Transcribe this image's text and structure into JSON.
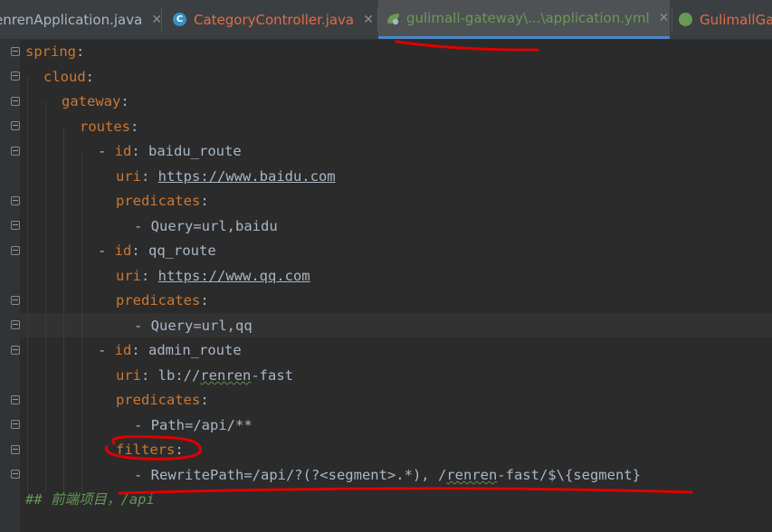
{
  "tabs": [
    {
      "label": "enrenApplication.java",
      "icon": "java-class-icon",
      "color": "#a9b7c6",
      "close": "✕"
    },
    {
      "label": "CategoryController.java",
      "icon": "java-class-icon",
      "icon_letter": "C",
      "color": "#e06c4b",
      "close": "✕"
    },
    {
      "label": "gulimall-gateway\\...\\application.yml",
      "icon": "spring-yaml-icon",
      "color": "#6a9955",
      "close": "✕",
      "active": true
    },
    {
      "label": "GulimallGat",
      "icon": "spring-boot-class-icon",
      "color": "#e06c4b"
    }
  ],
  "code": {
    "l1": {
      "key": "spring",
      "colon": ":"
    },
    "l2": {
      "key": "cloud",
      "colon": ":"
    },
    "l3": {
      "key": "gateway",
      "colon": ":"
    },
    "l4": {
      "key": "routes",
      "colon": ":"
    },
    "l5": {
      "dash": "- ",
      "key": "id",
      "colon": ": ",
      "value": "baidu_route"
    },
    "l6": {
      "key": "uri",
      "colon": ": ",
      "value": "https://www.baidu.com"
    },
    "l7": {
      "key": "predicates",
      "colon": ":"
    },
    "l8": {
      "dash": "- ",
      "value": "Query=url,baidu"
    },
    "l9": {
      "dash": "- ",
      "key": "id",
      "colon": ": ",
      "value": "qq_route"
    },
    "l10": {
      "key": "uri",
      "colon": ": ",
      "value": "https://www.qq.com"
    },
    "l11": {
      "key": "predicates",
      "colon": ":"
    },
    "l12": {
      "dash": "- ",
      "value": "Query=url,qq"
    },
    "l13": {
      "dash": "- ",
      "key": "id",
      "colon": ": ",
      "value": "admin_route"
    },
    "l14": {
      "key": "uri",
      "colon": ": ",
      "value_a": "lb://",
      "value_b": "renren",
      "value_c": "-fast"
    },
    "l15": {
      "key": "predicates",
      "colon": ":"
    },
    "l16": {
      "dash": "- ",
      "value": "Path=/api/**"
    },
    "l17": {
      "key": "filters",
      "colon": ":"
    },
    "l18": {
      "dash": "- ",
      "value_a": "RewritePath=/api/?(?<segment>.*), /",
      "value_b": "renren",
      "value_c": "-fast/$\\{segment}"
    },
    "l19": {
      "comment": "## 前端项目，/api"
    }
  },
  "colors": {
    "key": "#cc7832",
    "value": "#a9b7c6",
    "comment": "#629755",
    "annotation": "#e00000"
  }
}
